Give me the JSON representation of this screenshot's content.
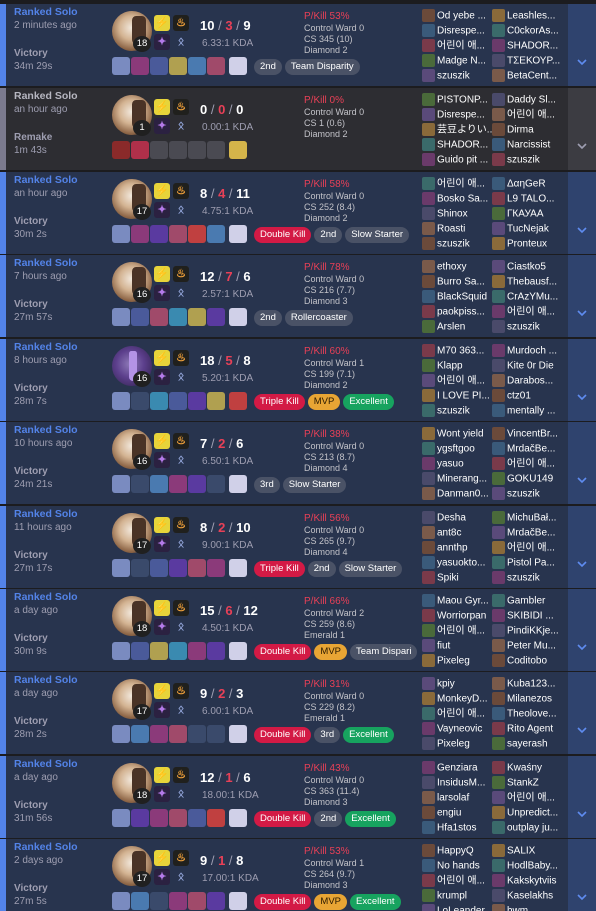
{
  "colors": {
    "win_accent": "#5383e8",
    "remake_accent": "#7b7a8e",
    "kill_red": "#e84057",
    "badge_red": "#d31a45",
    "mvp_gold": "#e8a534",
    "excellent_green": "#17a35f"
  },
  "icons": {
    "expand": "chevron-down-icon",
    "flash": "flash-spell-icon",
    "ignite": "ignite-spell-icon",
    "keystone": "keystone-rune-icon",
    "secondary_rune": "secondary-rune-icon",
    "ward": "ward-trinket-icon"
  },
  "matches": [
    {
      "queue": "Ranked Solo",
      "ago": "2 minutes ago",
      "result": "Victory",
      "duration": "34m 29s",
      "level": "18",
      "k": "10",
      "d": "3",
      "a": "9",
      "kda": "6.33:1 KDA",
      "pkill": "P/Kill 53%",
      "ward": "Control Ward 0",
      "cs": "CS 345 (10)",
      "rank": "Diamond 2",
      "badges": [
        {
          "text": "2nd",
          "kind": "gray"
        },
        {
          "text": "Team Disparity",
          "kind": "gray"
        }
      ],
      "items": [
        "#7a8bc0",
        "#8b3a7a",
        "#4a5a9a",
        "#b0a050",
        "#4a7ab0",
        "#a04a6a",
        "#d0d0e8"
      ],
      "team1": [
        "Od yebe ...",
        "Disrespe...",
        "어린이 애...",
        "Madge N...",
        "szuszik"
      ],
      "team2": [
        "Leashles...",
        "C0ckorAs...",
        "SHADOR...",
        "ΤΣΕΚΟΥΡ...",
        "BetaCent..."
      ]
    },
    {
      "queue": "Ranked Solo",
      "ago": "an hour ago",
      "result": "Remake",
      "duration": "1m 43s",
      "level": "1",
      "k": "0",
      "d": "0",
      "a": "0",
      "kda": "0.00:1 KDA",
      "pkill": "P/Kill 0%",
      "ward": "Control Ward 0",
      "cs": "CS 1 (0.6)",
      "rank": "Diamond 2",
      "badges": [],
      "items": [
        "#8a2a2a",
        "#b0304a",
        "",
        "",
        "",
        "",
        "#d4b44a"
      ],
      "team1": [
        "PISTONP...",
        "Disrespe...",
        "芸豆よりい...",
        "SHADOR...",
        "Guido pit ..."
      ],
      "team2": [
        "Daddy Sl...",
        "어린이 애...",
        "Dirma",
        "Narcissist",
        "szuszik"
      ]
    },
    {
      "queue": "Ranked Solo",
      "ago": "an hour ago",
      "result": "Victory",
      "duration": "30m 2s",
      "level": "17",
      "k": "8",
      "d": "4",
      "a": "11",
      "kda": "4.75:1 KDA",
      "pkill": "P/Kill 58%",
      "ward": "Control Ward 0",
      "cs": "CS 252 (8.4)",
      "rank": "Diamond 2",
      "badges": [
        {
          "text": "Double Kill",
          "kind": "red"
        },
        {
          "text": "2nd",
          "kind": "gray"
        },
        {
          "text": "Slow Starter",
          "kind": "gray"
        }
      ],
      "items": [
        "#7a8bc0",
        "#8b3a7a",
        "#5a3aa0",
        "#a04a6a",
        "#c04040",
        "#4a7ab0",
        "#d0d0e8"
      ],
      "team1": [
        "어린이 애...",
        "Bosko Sa...",
        "Shinox",
        "Roasti",
        "szuszik"
      ],
      "team2": [
        "ΔαηGeR",
        "L9 TALO...",
        "ГКАУАА",
        "TucNejak",
        "Pronteux"
      ]
    },
    {
      "queue": "Ranked Solo",
      "ago": "7 hours ago",
      "result": "Victory",
      "duration": "27m 57s",
      "level": "16",
      "k": "12",
      "d": "7",
      "a": "6",
      "kda": "2.57:1 KDA",
      "pkill": "P/Kill 78%",
      "ward": "Control Ward 0",
      "cs": "CS 216 (7.7)",
      "rank": "Diamond 3",
      "badges": [
        {
          "text": "2nd",
          "kind": "gray"
        },
        {
          "text": "Rollercoaster",
          "kind": "gray"
        }
      ],
      "items": [
        "#7a8bc0",
        "#4a5a9a",
        "#a04a6a",
        "#3a8ab0",
        "#b0a050",
        "#5a3aa0",
        "#d0d0e8"
      ],
      "team1": [
        "ethoxy",
        "Burro Sa...",
        "BlackSquid",
        "paokpiss...",
        "Arslen"
      ],
      "team2": [
        "Ciastko5",
        "Thebausf...",
        "CrAzYMu...",
        "어린이 애...",
        "szuszik"
      ]
    },
    {
      "queue": "Ranked Solo",
      "ago": "8 hours ago",
      "result": "Victory",
      "duration": "28m 7s",
      "level": "16",
      "k": "18",
      "d": "5",
      "a": "8",
      "kda": "5.20:1 KDA",
      "pkill": "P/Kill 60%",
      "ward": "Control Ward 1",
      "cs": "CS 199 (7.1)",
      "rank": "Diamond 2",
      "badges": [
        {
          "text": "Triple Kill",
          "kind": "red"
        },
        {
          "text": "MVP",
          "kind": "mvp"
        },
        {
          "text": "Excellent",
          "kind": "green"
        }
      ],
      "items": [
        "#7a8bc0",
        "",
        "#3a8ab0",
        "#4a5a9a",
        "#5a3aa0",
        "#b0a050",
        "#c04040"
      ],
      "team1": [
        "M70 363...",
        "Klapp",
        "어린이 애...",
        "I LOVE PI...",
        "szuszik"
      ],
      "team2": [
        "Murdoch ...",
        "Kite 0r Die",
        "Darabos...",
        "ctz01",
        "mentally ..."
      ]
    },
    {
      "queue": "Ranked Solo",
      "ago": "10 hours ago",
      "result": "Victory",
      "duration": "24m 21s",
      "level": "16",
      "k": "7",
      "d": "2",
      "a": "6",
      "kda": "6.50:1 KDA",
      "pkill": "P/Kill 38%",
      "ward": "Control Ward 0",
      "cs": "CS 213 (8.7)",
      "rank": "Diamond 4",
      "badges": [
        {
          "text": "3rd",
          "kind": "gray"
        },
        {
          "text": "Slow Starter",
          "kind": "gray"
        }
      ],
      "items": [
        "#7a8bc0",
        "",
        "#4a7ab0",
        "#8b3a7a",
        "#5a3aa0",
        "",
        "#d0d0e8"
      ],
      "team1": [
        "Wont yield",
        "ygsftgoo",
        "yasuo",
        "Minerang...",
        "Danman0..."
      ],
      "team2": [
        "VincentBr...",
        "MrdačBe...",
        "어린이 애...",
        "GOKU149",
        "szuszik"
      ]
    },
    {
      "queue": "Ranked Solo",
      "ago": "11 hours ago",
      "result": "Victory",
      "duration": "27m 17s",
      "level": "17",
      "k": "8",
      "d": "2",
      "a": "10",
      "kda": "9.00:1 KDA",
      "pkill": "P/Kill 56%",
      "ward": "Control Ward 0",
      "cs": "CS 265 (9.7)",
      "rank": "Diamond 4",
      "badges": [
        {
          "text": "Triple Kill",
          "kind": "red"
        },
        {
          "text": "2nd",
          "kind": "gray"
        },
        {
          "text": "Slow Starter",
          "kind": "gray"
        }
      ],
      "items": [
        "#7a8bc0",
        "",
        "#4a5a9a",
        "#5a3aa0",
        "#a04a6a",
        "#8b3a7a",
        "#d0d0e8"
      ],
      "team1": [
        "Desha",
        "ant8c",
        "annthp",
        "yasuokto...",
        "Spiki"
      ],
      "team2": [
        "MichuBał...",
        "MrdačBe...",
        "어린이 애...",
        "Pistol Pa...",
        "szuszik"
      ]
    },
    {
      "queue": "Ranked Solo",
      "ago": "a day ago",
      "result": "Victory",
      "duration": "30m 9s",
      "level": "18",
      "k": "15",
      "d": "6",
      "a": "12",
      "kda": "4.50:1 KDA",
      "pkill": "P/Kill 66%",
      "ward": "Control Ward 2",
      "cs": "CS 259 (8.6)",
      "rank": "Emerald 1",
      "badges": [
        {
          "text": "Double Kill",
          "kind": "red"
        },
        {
          "text": "MVP",
          "kind": "mvp"
        },
        {
          "text": "Team Dispari",
          "kind": "gray"
        }
      ],
      "items": [
        "#7a8bc0",
        "#4a5a9a",
        "#b0a050",
        "#3a8ab0",
        "#8b3a7a",
        "#5a3aa0",
        "#d0d0e8"
      ],
      "team1": [
        "Maou Gyr...",
        "Worriorpan",
        "어린이 애...",
        "fiut",
        "Pixeleg"
      ],
      "team2": [
        "Gambler",
        "SKIBIDI ...",
        "PindiKKje...",
        "Peter Mu...",
        "Coditobo"
      ]
    },
    {
      "queue": "Ranked Solo",
      "ago": "a day ago",
      "result": "Victory",
      "duration": "28m 2s",
      "level": "17",
      "k": "9",
      "d": "2",
      "a": "3",
      "kda": "6.00:1 KDA",
      "pkill": "P/Kill 31%",
      "ward": "Control Ward 0",
      "cs": "CS 229 (8.2)",
      "rank": "Emerald 1",
      "badges": [
        {
          "text": "Double Kill",
          "kind": "red"
        },
        {
          "text": "3rd",
          "kind": "gray"
        },
        {
          "text": "Excellent",
          "kind": "green"
        }
      ],
      "items": [
        "#7a8bc0",
        "#4a7ab0",
        "#8b3a7a",
        "#a04a6a",
        "",
        "",
        "#d0d0e8"
      ],
      "team1": [
        "kpiy",
        "MonkeyD...",
        "어린이 애...",
        "Vayneovic",
        "Pixeleg"
      ],
      "team2": [
        "Kuba123...",
        "Milanezos",
        "Theolove...",
        "Rito Agent",
        "sayerash"
      ]
    },
    {
      "queue": "Ranked Solo",
      "ago": "a day ago",
      "result": "Victory",
      "duration": "31m 56s",
      "level": "18",
      "k": "12",
      "d": "1",
      "a": "6",
      "kda": "18.00:1 KDA",
      "pkill": "P/Kill 43%",
      "ward": "Control Ward 0",
      "cs": "CS 363 (11.4)",
      "rank": "Diamond 3",
      "badges": [
        {
          "text": "Double Kill",
          "kind": "red"
        },
        {
          "text": "2nd",
          "kind": "gray"
        },
        {
          "text": "Excellent",
          "kind": "green"
        }
      ],
      "items": [
        "#7a8bc0",
        "#5a3aa0",
        "#8b3a7a",
        "#a04a6a",
        "#4a5a9a",
        "#c04040",
        "#d0d0e8"
      ],
      "team1": [
        "Genziara",
        "InsidusM...",
        "larsolaf",
        "engiu",
        "Hfa1stos"
      ],
      "team2": [
        "Kwaśny",
        "StankZ",
        "어린이 애...",
        "Unpredict...",
        "outplay ju..."
      ]
    },
    {
      "queue": "Ranked Solo",
      "ago": "2 days ago",
      "result": "Victory",
      "duration": "27m 5s",
      "level": "17",
      "k": "9",
      "d": "1",
      "a": "8",
      "kda": "17.00:1 KDA",
      "pkill": "P/Kill 53%",
      "ward": "Control Ward 1",
      "cs": "CS 264 (9.7)",
      "rank": "Diamond 3",
      "badges": [
        {
          "text": "Double Kill",
          "kind": "red"
        },
        {
          "text": "MVP",
          "kind": "mvp"
        },
        {
          "text": "Excellent",
          "kind": "green"
        }
      ],
      "items": [
        "#7a8bc0",
        "#4a7ab0",
        "",
        "#8b3a7a",
        "#a04a6a",
        "#5a3aa0",
        "#d0d0e8"
      ],
      "team1": [
        "HappyQ",
        "No hands",
        "어린이 애...",
        "krumpl",
        "LoLeander"
      ],
      "team2": [
        "SALIX",
        "HodlBaby...",
        "Kakskytviis",
        "Kaselakhs",
        "hwm"
      ]
    }
  ]
}
